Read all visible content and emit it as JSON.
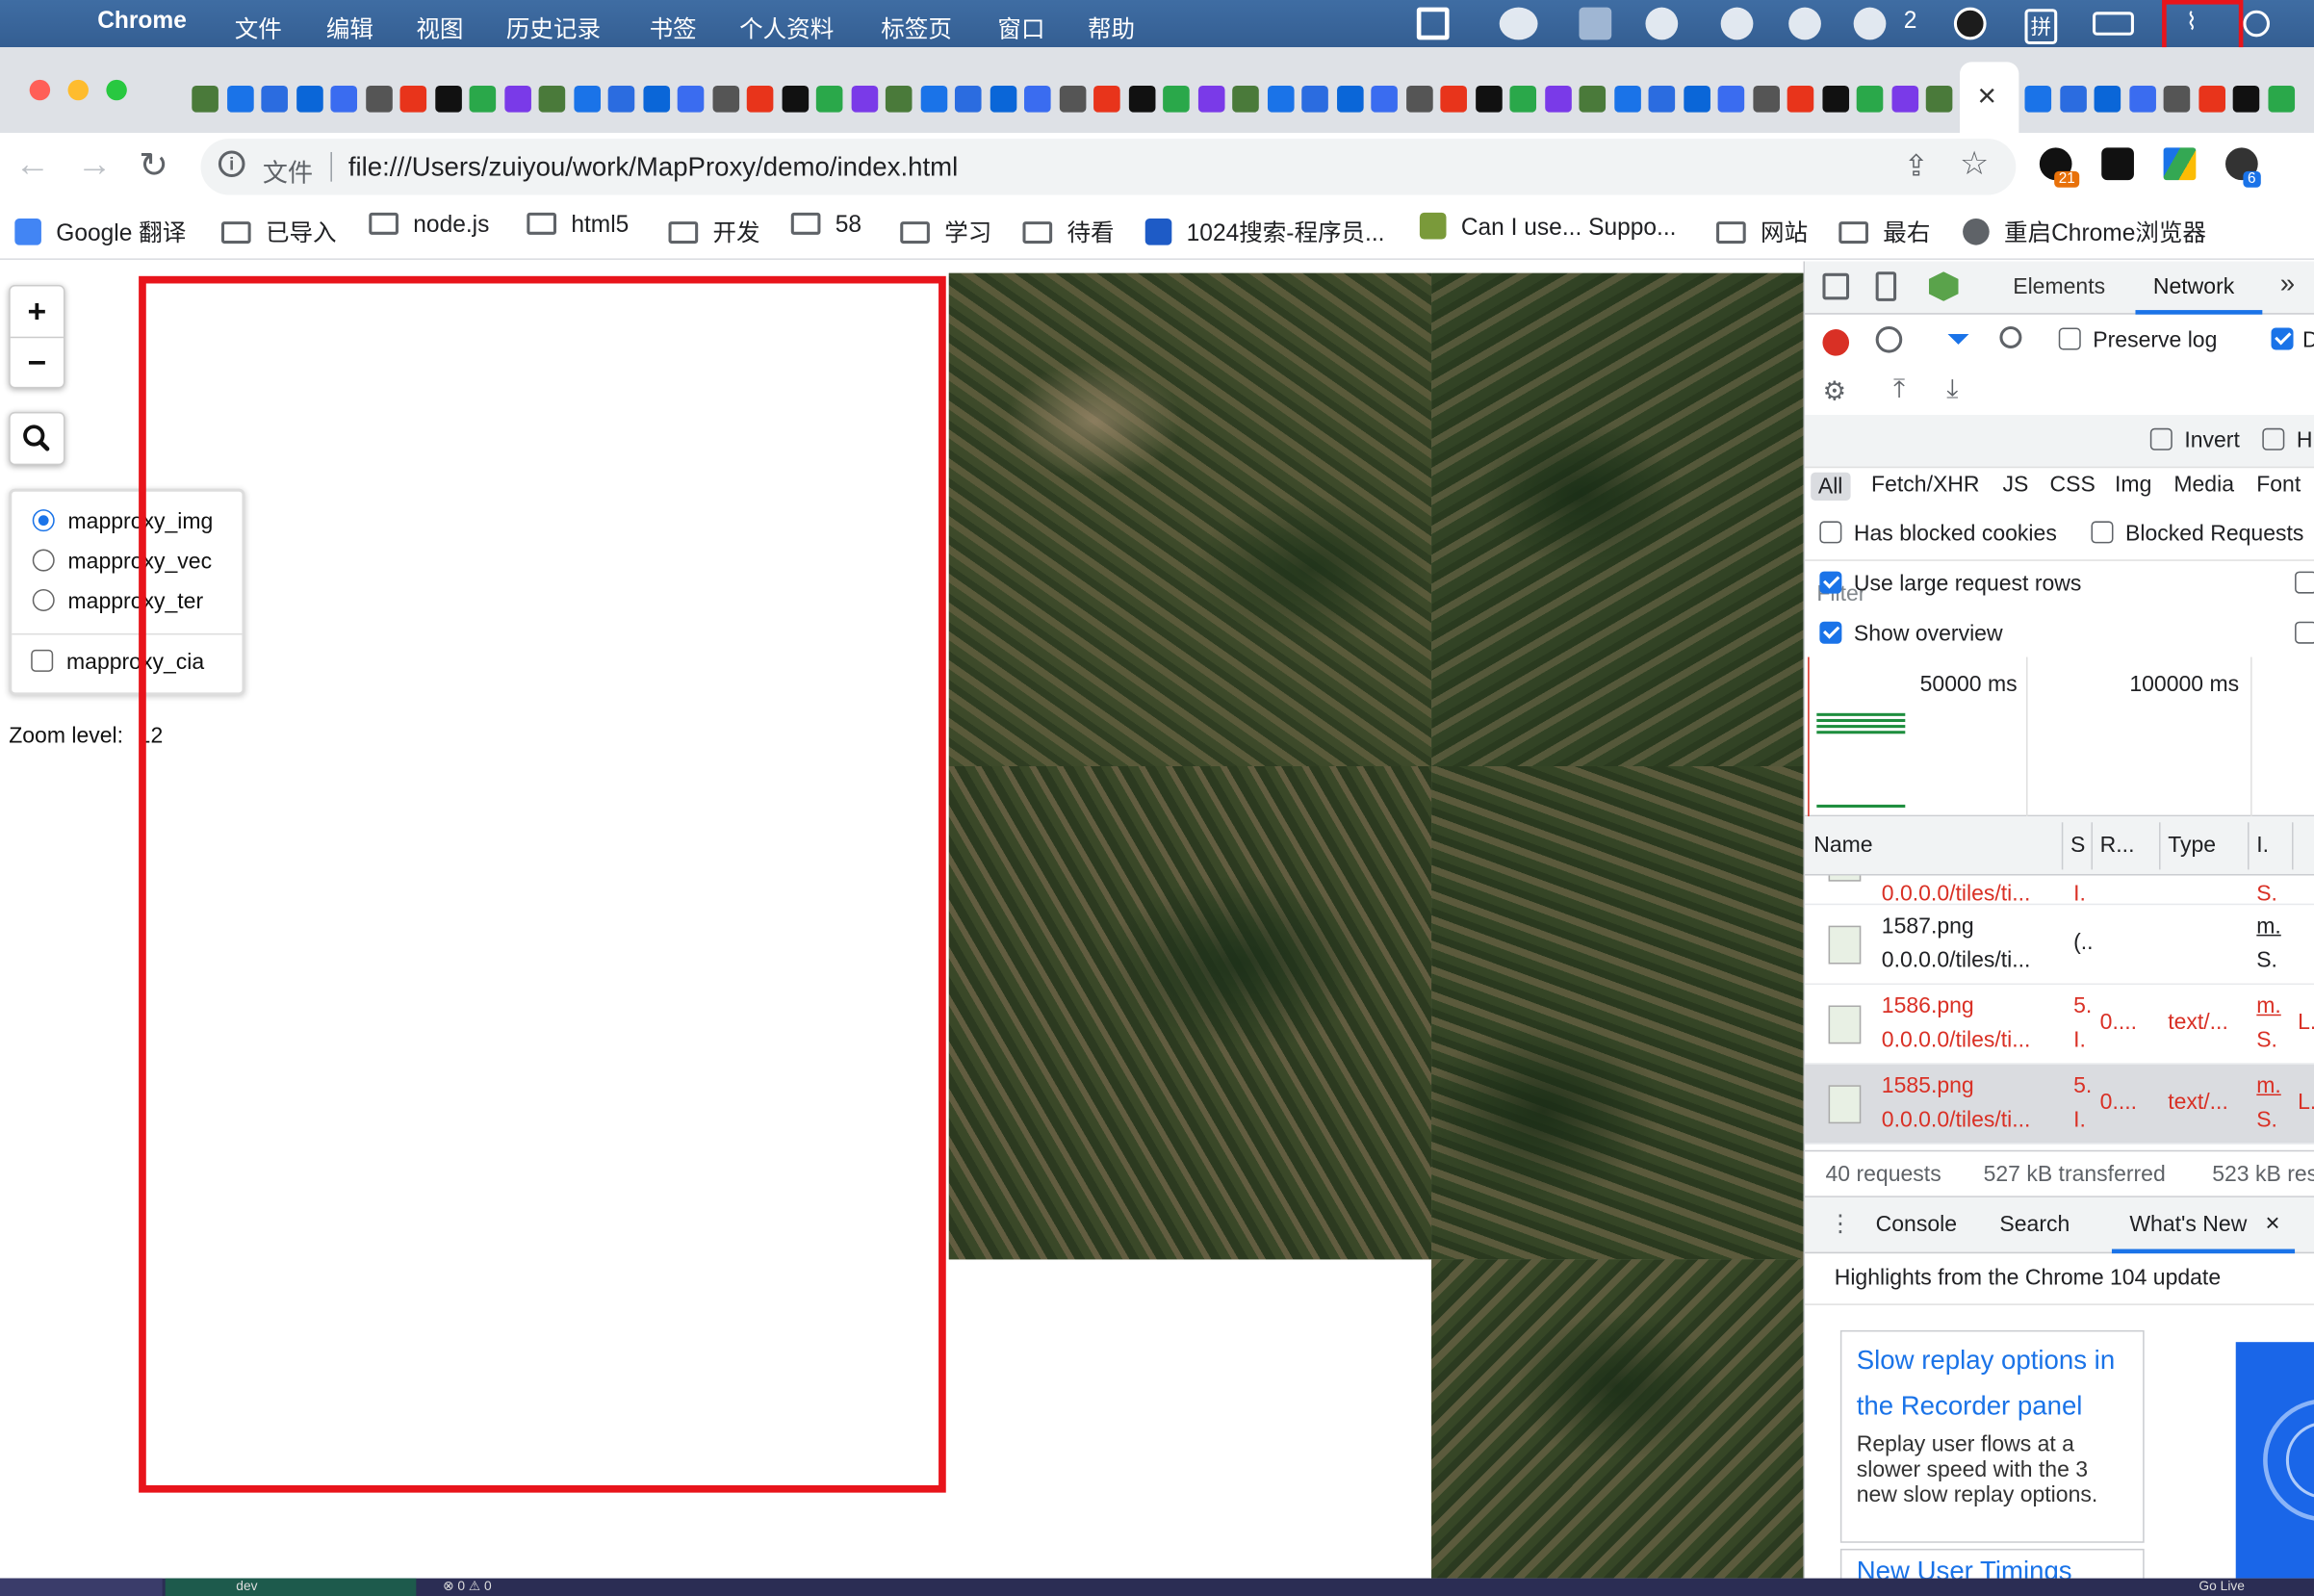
{
  "menubar": {
    "app": "Chrome",
    "items": [
      "文件",
      "编辑",
      "视图",
      "历史记录",
      "书签",
      "个人资料",
      "标签页",
      "窗口",
      "帮助"
    ],
    "wechat_badge": "2",
    "input_method": "拼"
  },
  "tabs": {
    "active_close": "×"
  },
  "toolbar": {
    "scheme_label": "文件",
    "url": "file:///Users/zuiyou/work/MapProxy/demo/index.html",
    "ext_badge_1": "21",
    "ext_badge_2": "6"
  },
  "bookmarks": [
    {
      "label": "Google 翻译",
      "kind": "site"
    },
    {
      "label": "已导入",
      "kind": "folder"
    },
    {
      "label": "node.js",
      "kind": "folder"
    },
    {
      "label": "html5",
      "kind": "folder"
    },
    {
      "label": "开发",
      "kind": "folder"
    },
    {
      "label": "58",
      "kind": "folder"
    },
    {
      "label": "学习",
      "kind": "folder"
    },
    {
      "label": "待看",
      "kind": "folder"
    },
    {
      "label": "1024搜索-程序员...",
      "kind": "site"
    },
    {
      "label": "Can I use... Suppo...",
      "kind": "site"
    },
    {
      "label": "网站",
      "kind": "folder"
    },
    {
      "label": "最右",
      "kind": "folder"
    },
    {
      "label": "重启Chrome浏览器",
      "kind": "site"
    }
  ],
  "map": {
    "zoom_in": "+",
    "zoom_out": "−",
    "layers": {
      "base": [
        {
          "label": "mapproxy_img",
          "checked": true
        },
        {
          "label": "mapproxy_vec",
          "checked": false
        },
        {
          "label": "mapproxy_ter",
          "checked": false
        }
      ],
      "overlay": [
        {
          "label": "mapproxy_cia",
          "checked": false
        }
      ]
    },
    "zoom_level_label": "Zoom level:",
    "zoom_level_value": "12"
  },
  "devtools": {
    "tabs": [
      "Elements",
      "Network"
    ],
    "active_tab": "Network",
    "more": "»",
    "preserve_log": "Preserve log",
    "disable_cache_cut": "D",
    "filter_placeholder": "Filter",
    "invert": "Invert",
    "hide_cut": "H",
    "types": [
      "All",
      "Fetch/XHR",
      "JS",
      "CSS",
      "Img",
      "Media",
      "Font"
    ],
    "has_blocked_cookies": "Has blocked cookies",
    "blocked_requests": "Blocked Requests",
    "use_large_rows": "Use large request rows",
    "show_overview": "Show overview",
    "overview_ticks": [
      "50000 ms",
      "100000 ms"
    ],
    "columns": [
      "Name",
      "S",
      "R...",
      "Type",
      "I."
    ],
    "rows": [
      {
        "name": "",
        "path": "0.0.0.0/tiles/ti...",
        "s1": "",
        "s2": "I.",
        "r": "",
        "type": "",
        "i1": "",
        "i2": "S.",
        "extra": "",
        "error": true
      },
      {
        "name": "1587.png",
        "path": "0.0.0.0/tiles/ti...",
        "s1": "(..",
        "s2": "",
        "r": "",
        "type": "",
        "i1": "m.",
        "i2": "S.",
        "extra": "",
        "error": false
      },
      {
        "name": "1586.png",
        "path": "0.0.0.0/tiles/ti...",
        "s1": "5.",
        "s2": "I.",
        "r": "0....",
        "type": "text/...",
        "i1": "m.",
        "i2": "S.",
        "extra": "L.",
        "error": true
      },
      {
        "name": "1585.png",
        "path": "0.0.0.0/tiles/ti...",
        "s1": "5.",
        "s2": "I.",
        "r": "0....",
        "type": "text/...",
        "i1": "m.",
        "i2": "S.",
        "extra": "L.",
        "error": true
      }
    ],
    "summary": {
      "requests": "40 requests",
      "transferred": "527 kB transferred",
      "resources": "523 kB res"
    },
    "drawer_tabs": [
      "Console",
      "Search",
      "What's New"
    ],
    "drawer_close": "×",
    "whats_new_heading": "Highlights from the Chrome 104 update",
    "card_title": "Slow replay options in the Recorder panel",
    "card_body": "Replay user flows at a slower speed with the 3 new slow replay options.",
    "card2_title": "New User Timings"
  },
  "dock": {
    "text_a": "dev",
    "text_b": "⊗ 0 ⚠ 0",
    "text_c": "Go Live"
  },
  "colors": {
    "annotation_red": "#e8141b",
    "devtools_blue": "#1a73e8",
    "error_red": "#d93025"
  }
}
